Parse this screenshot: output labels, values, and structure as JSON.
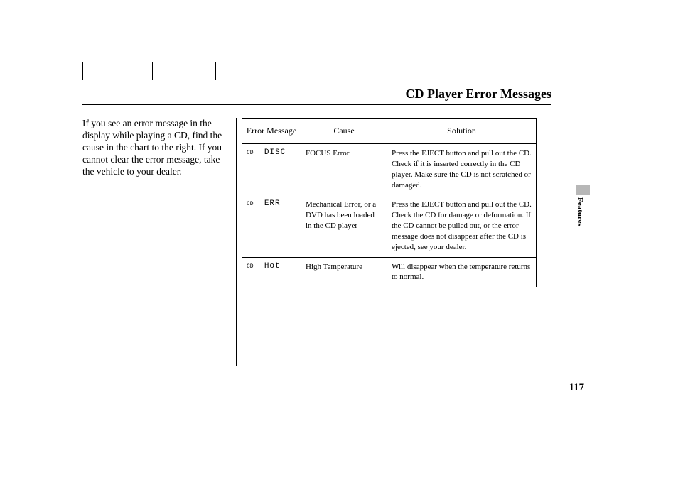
{
  "title": "CD Player Error Messages",
  "intro": "If you see an error message in the display while playing a CD, find the cause in the chart to the right. If you cannot clear the error message, take the vehicle to your dealer.",
  "side_label": "Features",
  "page_number": "117",
  "table": {
    "headers": {
      "msg": "Error Message",
      "cause": "Cause",
      "solution": "Solution"
    },
    "rows": [
      {
        "msg_prefix": "CD",
        "msg": "DISC",
        "cause": "FOCUS Error",
        "solution": "Press the EJECT button and pull out the CD. Check if it is inserted correctly in the CD player. Make sure the CD is not scratched or damaged."
      },
      {
        "msg_prefix": "CD",
        "msg": "ERR",
        "cause": "Mechanical Error, or a DVD has been loaded in the CD player",
        "solution": "Press the EJECT button and pull out the CD. Check the CD for damage or deformation. If the CD cannot be pulled out, or the error message does not disappear after the CD is ejected, see your dealer."
      },
      {
        "msg_prefix": "CD",
        "msg": "Hot",
        "cause": "High Temperature",
        "solution": "Will disappear when the temperature returns to normal."
      }
    ]
  }
}
